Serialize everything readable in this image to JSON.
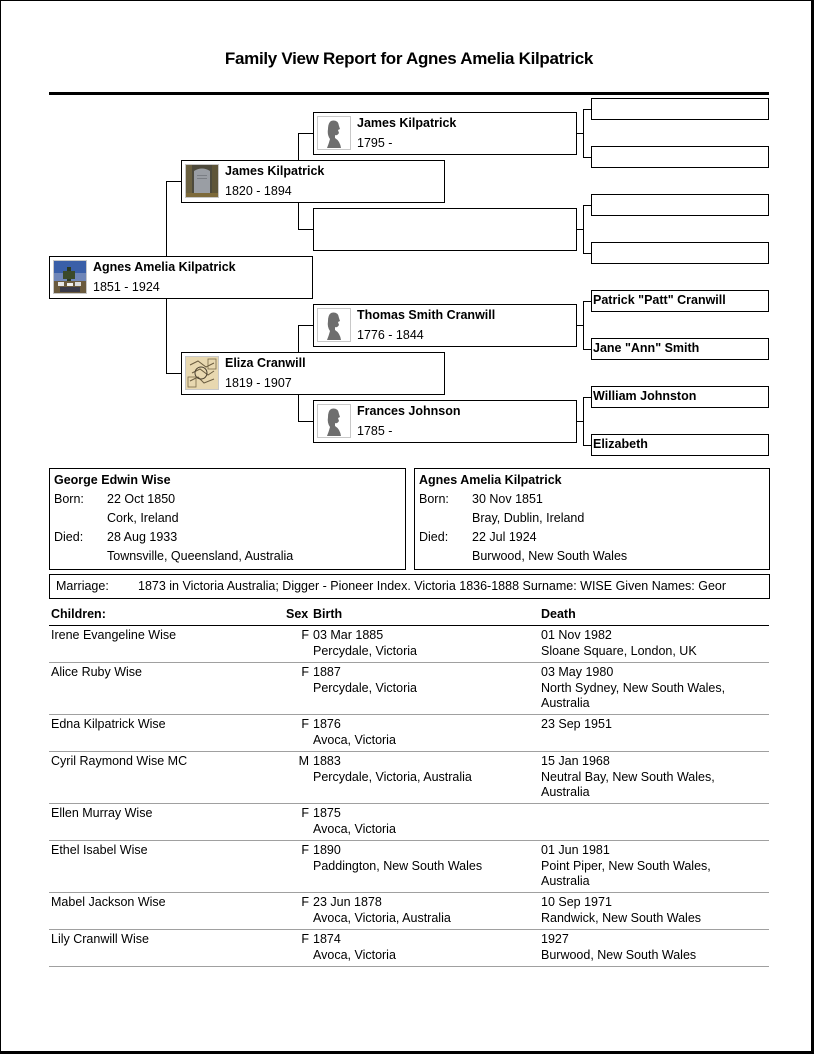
{
  "report": {
    "title": "Family View Report for Agnes Amelia Kilpatrick"
  },
  "pedigree": {
    "subject": {
      "name": "Agnes Amelia Kilpatrick",
      "dates": "1851 - 1924",
      "photo": "cemetery-photo"
    },
    "father": {
      "name": "James Kilpatrick",
      "dates": "1820 - 1894",
      "photo": "headstone-photo"
    },
    "mother": {
      "name": "Eliza Cranwill",
      "dates": "1819 - 1907",
      "photo": "map-photo"
    },
    "paternal_grandfather": {
      "name": "James Kilpatrick",
      "dates": "1795 -",
      "photo": "silhouette"
    },
    "paternal_grandmother": {
      "name": "",
      "dates": ""
    },
    "maternal_grandfather": {
      "name": "Thomas Smith Cranwill",
      "dates": "1776 - 1844",
      "photo": "silhouette"
    },
    "maternal_grandmother": {
      "name": "Frances Johnson",
      "dates": "1785 -",
      "photo": "silhouette"
    },
    "great_grandparents": [
      {
        "name": ""
      },
      {
        "name": ""
      },
      {
        "name": ""
      },
      {
        "name": ""
      },
      {
        "name": "Patrick \"Patt\" Cranwill"
      },
      {
        "name": "Jane \"Ann\" Smith"
      },
      {
        "name": "William Johnston"
      },
      {
        "name": "Elizabeth"
      }
    ]
  },
  "husband": {
    "name": "George Edwin Wise",
    "born_label": "Born:",
    "born_date": "22 Oct 1850",
    "born_place": "Cork, Ireland",
    "died_label": "Died:",
    "died_date": "28 Aug 1933",
    "died_place": "Townsville, Queensland, Australia"
  },
  "wife": {
    "name": "Agnes Amelia Kilpatrick",
    "born_label": "Born:",
    "born_date": "30 Nov 1851",
    "born_place": "Bray, Dublin, Ireland",
    "died_label": "Died:",
    "died_date": "22 Jul 1924",
    "died_place": "Burwood, New South Wales"
  },
  "marriage": {
    "label": "Marriage:",
    "value": "1873 in Victoria Australia; Digger - Pioneer Index. Victoria 1836-1888 Surname: WISE Given Names: Geor"
  },
  "children": {
    "headers": {
      "name": "Children:",
      "sex": "Sex",
      "birth": "Birth",
      "death": "Death"
    },
    "rows": [
      {
        "name": "Irene Evangeline Wise",
        "sex": "F",
        "birth": [
          "03 Mar 1885",
          "Percydale, Victoria"
        ],
        "death": [
          "01 Nov 1982",
          "Sloane Square, London, UK"
        ]
      },
      {
        "name": "Alice Ruby Wise",
        "sex": "F",
        "birth": [
          "1887",
          "Percydale, Victoria"
        ],
        "death": [
          "03 May 1980",
          "North Sydney, New South Wales,",
          "Australia"
        ]
      },
      {
        "name": "Edna Kilpatrick Wise",
        "sex": "F",
        "birth": [
          "1876",
          "Avoca, Victoria"
        ],
        "death": [
          "23 Sep 1951"
        ]
      },
      {
        "name": "Cyril Raymond Wise MC",
        "sex": "M",
        "birth": [
          "1883",
          "Percydale, Victoria, Australia"
        ],
        "death": [
          "15 Jan 1968",
          "Neutral Bay, New South Wales,",
          "Australia"
        ]
      },
      {
        "name": "Ellen Murray Wise",
        "sex": "F",
        "birth": [
          "1875",
          "Avoca, Victoria"
        ],
        "death": []
      },
      {
        "name": "Ethel Isabel Wise",
        "sex": "F",
        "birth": [
          "1890",
          "Paddington, New South Wales"
        ],
        "death": [
          "01 Jun 1981",
          "Point Piper, New South Wales,",
          "Australia"
        ]
      },
      {
        "name": "Mabel Jackson Wise",
        "sex": "F",
        "birth": [
          "23 Jun 1878",
          "Avoca, Victoria, Australia"
        ],
        "death": [
          "10 Sep 1971",
          "Randwick, New South Wales"
        ]
      },
      {
        "name": "Lily Cranwill Wise",
        "sex": "F",
        "birth": [
          "1874",
          "Avoca, Victoria"
        ],
        "death": [
          "1927",
          "Burwood, New South Wales"
        ]
      }
    ]
  }
}
